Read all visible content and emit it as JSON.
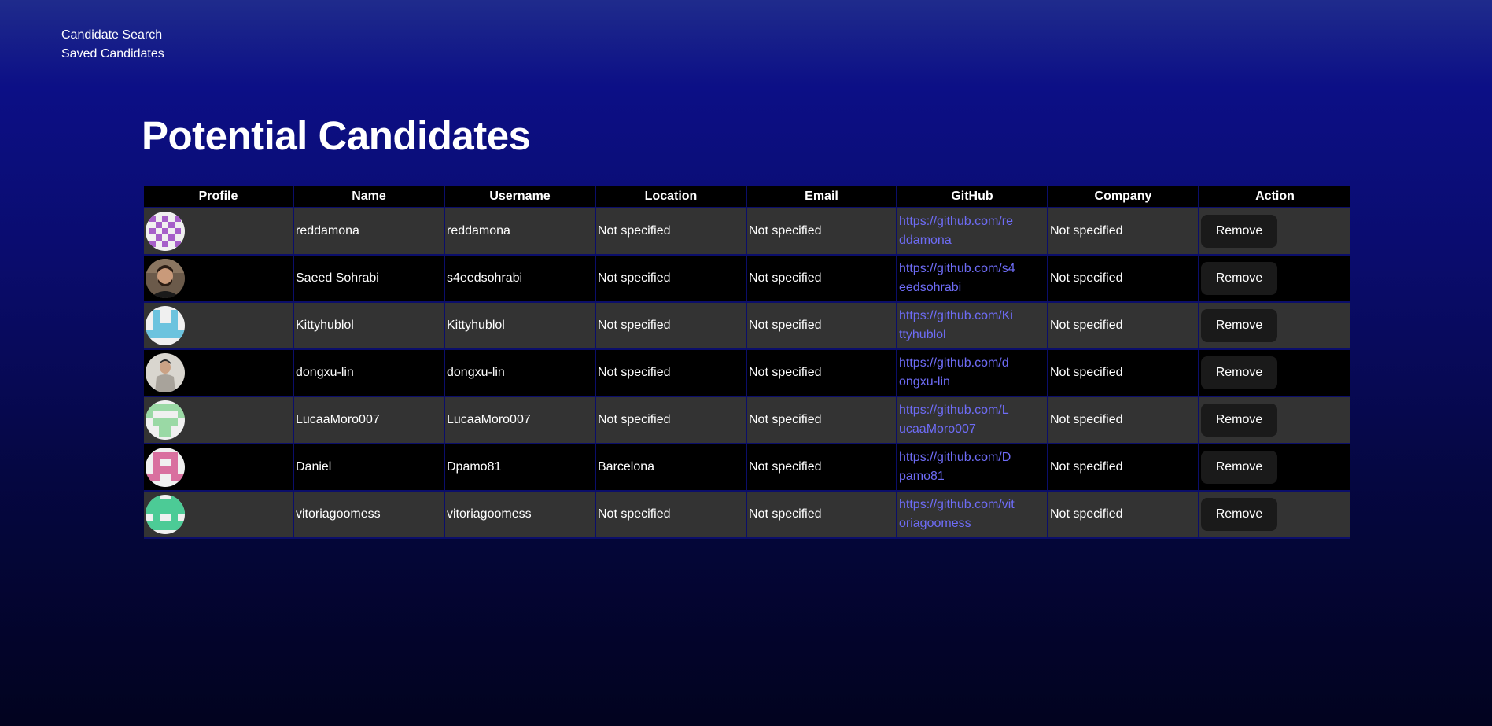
{
  "nav": {
    "candidate_search": "Candidate Search",
    "saved_candidates": "Saved Candidates"
  },
  "page_title": "Potential Candidates",
  "table": {
    "headers": [
      "Profile",
      "Name",
      "Username",
      "Location",
      "Email",
      "GitHub",
      "Company",
      "Action"
    ],
    "rows": [
      {
        "name": "reddamona",
        "username": "reddamona",
        "location": "Not specified",
        "email": "Not specified",
        "github": "https://github.com/reddamona",
        "company": "Not specified",
        "action": "Remove",
        "avatar": "identicon-purple-checker"
      },
      {
        "name": "Saeed Sohrabi",
        "username": "s4eedsohrabi",
        "location": "Not specified",
        "email": "Not specified",
        "github": "https://github.com/s4eedsohrabi",
        "company": "Not specified",
        "action": "Remove",
        "avatar": "photo-person"
      },
      {
        "name": "Kittyhublol",
        "username": "Kittyhublol",
        "location": "Not specified",
        "email": "Not specified",
        "github": "https://github.com/Kittyhublol",
        "company": "Not specified",
        "action": "Remove",
        "avatar": "identicon-blue"
      },
      {
        "name": "dongxu-lin",
        "username": "dongxu-lin",
        "location": "Not specified",
        "email": "Not specified",
        "github": "https://github.com/dongxu-lin",
        "company": "Not specified",
        "action": "Remove",
        "avatar": "photo-person-light"
      },
      {
        "name": "LucaaMoro007",
        "username": "LucaaMoro007",
        "location": "Not specified",
        "email": "Not specified",
        "github": "https://github.com/LucaaMoro007",
        "company": "Not specified",
        "action": "Remove",
        "avatar": "identicon-green"
      },
      {
        "name": "Daniel",
        "username": "Dpamo81",
        "location": "Barcelona",
        "email": "Not specified",
        "github": "https://github.com/Dpamo81",
        "company": "Not specified",
        "action": "Remove",
        "avatar": "identicon-pink"
      },
      {
        "name": "vitoriagoomess",
        "username": "vitoriagoomess",
        "location": "Not specified",
        "email": "Not specified",
        "github": "https://github.com/vitoriagoomess",
        "company": "Not specified",
        "action": "Remove",
        "avatar": "identicon-teal"
      }
    ]
  },
  "colors": {
    "link": "#6e6cf6",
    "header_bg": "#000000",
    "row_light": "#333333",
    "row_dark": "#000000",
    "button_bg": "#1a1a1a"
  }
}
